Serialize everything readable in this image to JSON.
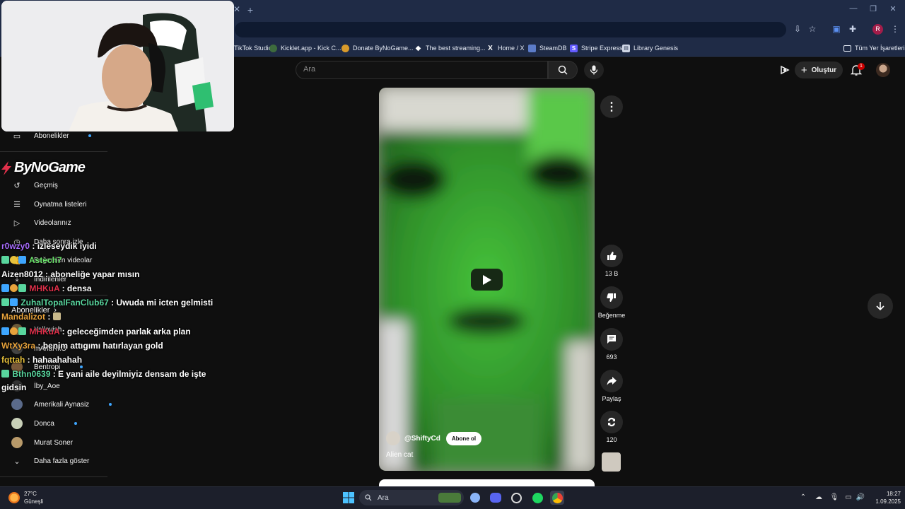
{
  "browser": {
    "bookmarks": [
      {
        "label": "TikTok Studio",
        "icon": "tiktok-icon",
        "color": "#1f2b46"
      },
      {
        "label": "Kicklet.app - Kick C...",
        "icon": "kicklet-icon",
        "color": "#3d6b3d"
      },
      {
        "label": "Donate ByNoGame...",
        "icon": "donate-icon",
        "color": "#d89a2b"
      },
      {
        "label": "The best streaming...",
        "icon": "diamond-icon",
        "color": "#ffffff"
      },
      {
        "label": "Home / X",
        "icon": "x-icon",
        "color": "#000000"
      },
      {
        "label": "SteamDB",
        "icon": "steamdb-icon",
        "color": "#5c7cc8"
      },
      {
        "label": "Stripe Express",
        "icon": "stripe-icon",
        "color": "#635bff"
      },
      {
        "label": "Library Genesis",
        "icon": "library-icon",
        "color": "#cfd6e6"
      }
    ],
    "all_bookmarks": "Tüm Yer İşaretleri",
    "profile_initial": "R"
  },
  "youtube": {
    "search_placeholder": "Ara",
    "create_label": "Oluştur",
    "notification_count": "1"
  },
  "sidebar": {
    "subscriptions_label": "Abonelikler",
    "brand": "ByNoGame",
    "you_items": [
      {
        "label": "Geçmiş",
        "icon": "history-icon"
      },
      {
        "label": "Oynatma listeleri",
        "icon": "playlist-icon"
      },
      {
        "label": "Videolarınız",
        "icon": "video-icon"
      },
      {
        "label": "Daha sonra izle",
        "icon": "clock-icon"
      },
      {
        "label": "Beğenilen videolar",
        "icon": "like-icon"
      },
      {
        "label": "İndirilenler",
        "icon": "download-icon"
      }
    ],
    "subs_header": "Abonelikler",
    "subs": [
      {
        "label": "Yallovish"
      },
      {
        "label": "mAnaRkO"
      },
      {
        "label": "Bentropi"
      },
      {
        "label": "İby_Aoe"
      },
      {
        "label": "Amerikali Aynasiz"
      },
      {
        "label": "Donca"
      },
      {
        "label": "Murat Soner"
      }
    ],
    "show_more": "Daha fazla göster"
  },
  "chat": [
    {
      "user": "r0wzy0",
      "text": "izleseydik iyidi",
      "color": "#a86cff"
    },
    {
      "user": "Astech7",
      "text": "",
      "color": "#6be36b"
    },
    {
      "user": "Aizen8012",
      "text": "aboneliğe yapar mısın",
      "color": "#ffffff"
    },
    {
      "user": "MHKuA",
      "text": "densa",
      "color": "#e0304a"
    },
    {
      "user": "ZuhalTopalFanClub67",
      "text": "Uwuda mi icten gelmisti",
      "color": "#59d69e"
    },
    {
      "user": "Mandalizot",
      "text": "",
      "color": "#e8a33c"
    },
    {
      "user": "MHKuA",
      "text": "geleceğimden parlak arka plan",
      "color": "#e0304a"
    },
    {
      "user": "WtXy3ra",
      "text": "benim attıgımı hatırlayan gold",
      "color": "#e8a33c"
    },
    {
      "user": "fqttah",
      "text": "hahaahahah",
      "color": "#e8c23c"
    },
    {
      "user": "Bthn0639",
      "text": "E yani aile deyilmiyiz densam de işte",
      "color": "#59d69e"
    },
    {
      "user": "",
      "text": "gidsin",
      "color": "#ffffff"
    }
  ],
  "short": {
    "channel": "@ShiftyCd",
    "subscribe": "Abone ol",
    "title": "Alien cat",
    "likes": "13 B",
    "dislike_label": "Beğenme",
    "comments": "693",
    "share_label": "Paylaş",
    "remix": "120"
  },
  "taskbar": {
    "temperature": "27°C",
    "weather": "Güneşli",
    "search": "Ara",
    "time": "18:27",
    "date": "1.09.2025"
  }
}
